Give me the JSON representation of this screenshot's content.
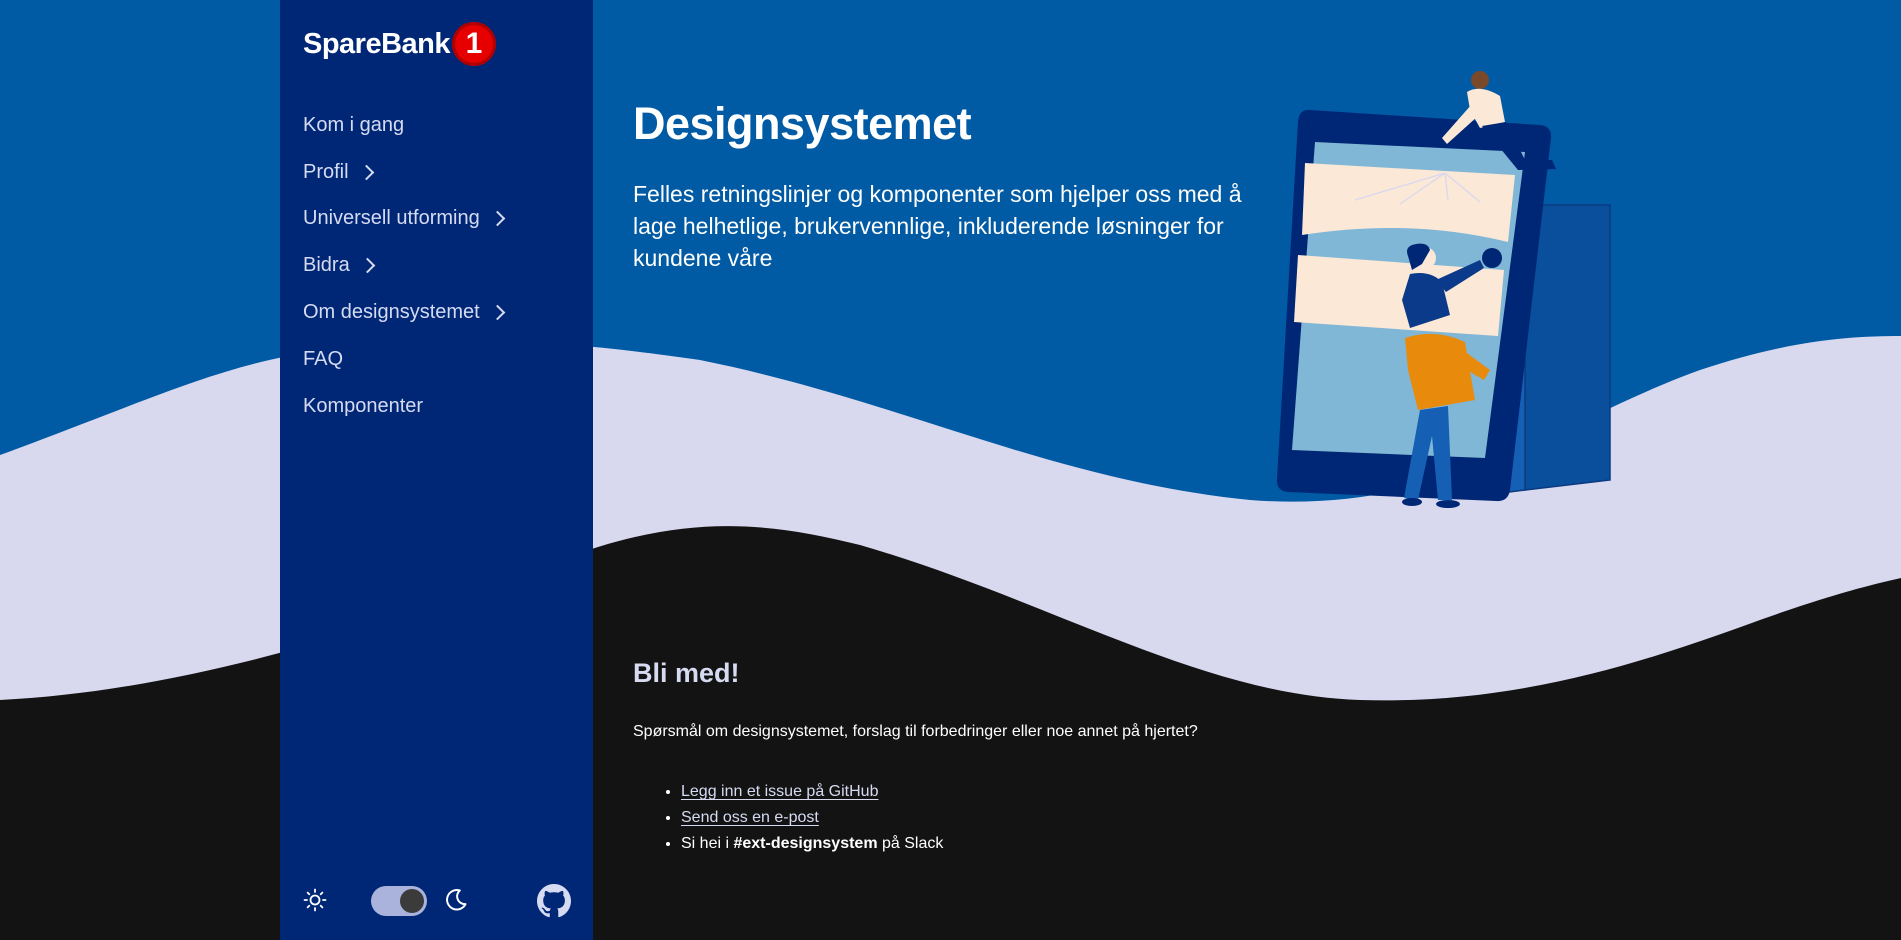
{
  "brand": {
    "name": "SpareBank",
    "badge_number": "1",
    "colors": {
      "primary_blue": "#005aa4",
      "sidebar_navy": "#002776",
      "wave_lavender": "#d8d8ee",
      "footer_black": "#131313",
      "logo_red": "#e60000"
    }
  },
  "sidebar": {
    "items": [
      {
        "label": "Kom i gang",
        "has_children": false
      },
      {
        "label": "Profil",
        "has_children": true
      },
      {
        "label": "Universell utforming",
        "has_children": true
      },
      {
        "label": "Bidra",
        "has_children": true
      },
      {
        "label": "Om designsystemet",
        "has_children": true
      },
      {
        "label": "FAQ",
        "has_children": false
      },
      {
        "label": "Komponenter",
        "has_children": false
      }
    ],
    "footer": {
      "theme_toggle_state": "dark",
      "icons": [
        "sun-icon",
        "moon-icon",
        "github-icon"
      ]
    }
  },
  "hero": {
    "title": "Designsystemet",
    "lead": "Felles retningslinjer og komponenter som hjelper oss med å lage helhetlige, brukervennlige, inkluderende løsninger for kundene våre"
  },
  "join": {
    "title": "Bli med!",
    "text": "Spørsmål om designsystemet, forslag til forbedringer eller noe annet på hjertet?",
    "links": {
      "github": "Legg inn et issue på GitHub",
      "email": "Send oss en e-post"
    },
    "slack": {
      "prefix": "Si hei i",
      "channel": "#ext-designsystem",
      "suffix": "på Slack"
    }
  }
}
